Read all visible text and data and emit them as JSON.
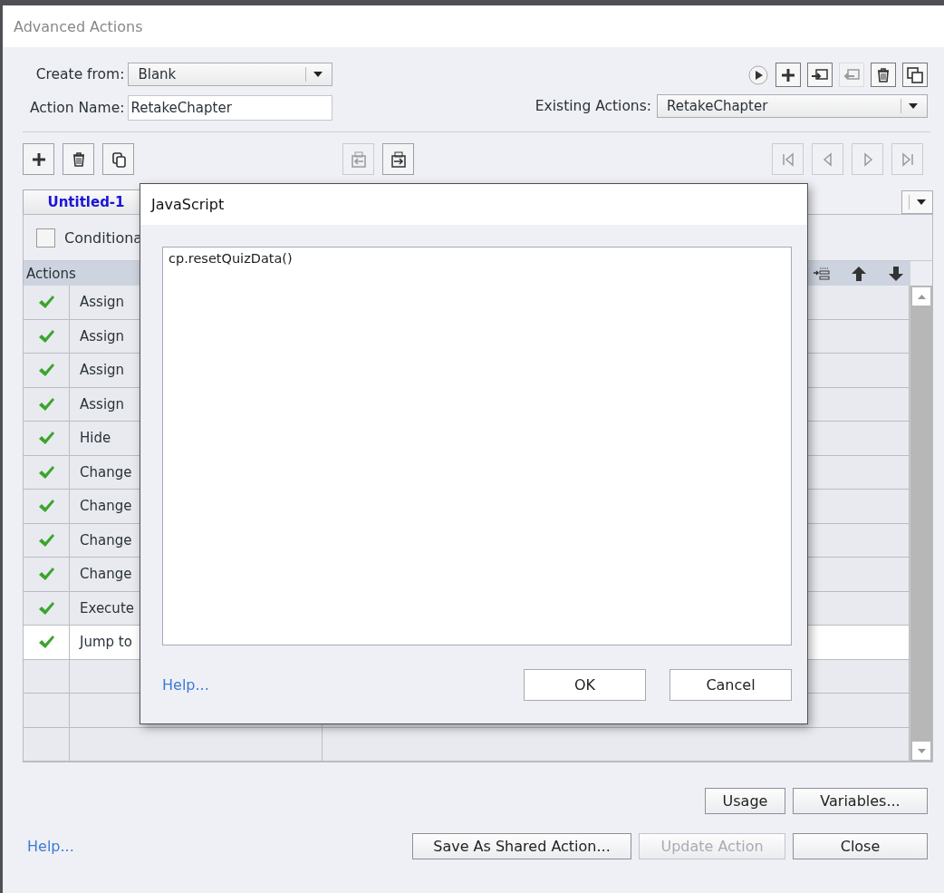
{
  "window": {
    "title": "Advanced Actions"
  },
  "create_from": {
    "label": "Create from:",
    "value": "Blank"
  },
  "action_name": {
    "label": "Action Name:",
    "value": "RetakeChapter"
  },
  "top_tools": [
    {
      "kind": "play",
      "disabled": false
    },
    {
      "kind": "add",
      "disabled": false
    },
    {
      "kind": "import",
      "disabled": false
    },
    {
      "kind": "export",
      "disabled": true
    },
    {
      "kind": "delete",
      "disabled": false
    },
    {
      "kind": "duplicate",
      "disabled": false
    }
  ],
  "existing_actions": {
    "label": "Existing Actions:",
    "value": "RetakeChapter"
  },
  "action_tools": [
    {
      "kind": "add",
      "disabled": false
    },
    {
      "kind": "delete",
      "disabled": false
    },
    {
      "kind": "copy",
      "disabled": false
    }
  ],
  "clip_tools": [
    {
      "kind": "paste-in",
      "disabled": true
    },
    {
      "kind": "paste-out",
      "disabled": false
    }
  ],
  "nav_tools": [
    {
      "kind": "first",
      "disabled": true
    },
    {
      "kind": "prev",
      "disabled": true
    },
    {
      "kind": "next",
      "disabled": true
    },
    {
      "kind": "last",
      "disabled": true
    }
  ],
  "tab": {
    "label": "Untitled-1"
  },
  "conditional": {
    "label": "Conditiona",
    "checked": false
  },
  "table": {
    "header": "Actions",
    "tools": [
      {
        "kind": "indent"
      },
      {
        "kind": "up"
      },
      {
        "kind": "down"
      }
    ],
    "rows": [
      {
        "checked": true,
        "action": "Assign",
        "selected": false
      },
      {
        "checked": true,
        "action": "Assign",
        "selected": false
      },
      {
        "checked": true,
        "action": "Assign",
        "selected": false
      },
      {
        "checked": true,
        "action": "Assign",
        "selected": false
      },
      {
        "checked": true,
        "action": "Hide",
        "selected": false
      },
      {
        "checked": true,
        "action": "Change",
        "selected": false
      },
      {
        "checked": true,
        "action": "Change",
        "selected": false
      },
      {
        "checked": true,
        "action": "Change",
        "selected": false
      },
      {
        "checked": true,
        "action": "Change",
        "selected": false
      },
      {
        "checked": true,
        "action": "Execute",
        "selected": false
      },
      {
        "checked": true,
        "action": "Jump to",
        "selected": true
      }
    ]
  },
  "side_buttons": [
    {
      "label": "Usage",
      "disabled": false
    },
    {
      "label": "Variables...",
      "disabled": false
    }
  ],
  "help": "Help...",
  "bottom_buttons": [
    {
      "label": "Save As Shared Action...",
      "disabled": false
    },
    {
      "label": "Update Action",
      "disabled": true
    },
    {
      "label": "Close",
      "disabled": false
    }
  ],
  "dialog": {
    "title": "JavaScript",
    "code": "cp.resetQuizData()",
    "help": "Help...",
    "buttons": [
      {
        "label": "OK"
      },
      {
        "label": "Cancel"
      }
    ]
  }
}
